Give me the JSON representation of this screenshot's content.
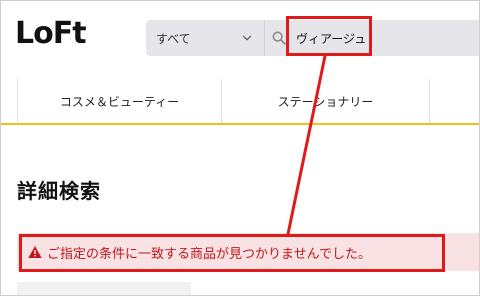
{
  "header": {
    "logo_text": "LoFt",
    "search": {
      "category_selected": "すべて",
      "query_value": "ヴィアージュ"
    }
  },
  "nav": {
    "items": [
      {
        "label": "コスメ＆ビューティー"
      },
      {
        "label": "ステーショナリー"
      }
    ]
  },
  "main": {
    "title": "詳細検索",
    "alert_message": "ご指定の条件に一致する商品が見つかりませんでした。"
  },
  "colors": {
    "highlight": "#e01a1a",
    "alert_text": "#c3171b",
    "alert_bg": "#f9e2e3",
    "nav_underline": "#f2c21b"
  },
  "icons": {
    "search": "search-icon",
    "dropdown": "chevron-down-icon",
    "warning": "warning-icon"
  }
}
